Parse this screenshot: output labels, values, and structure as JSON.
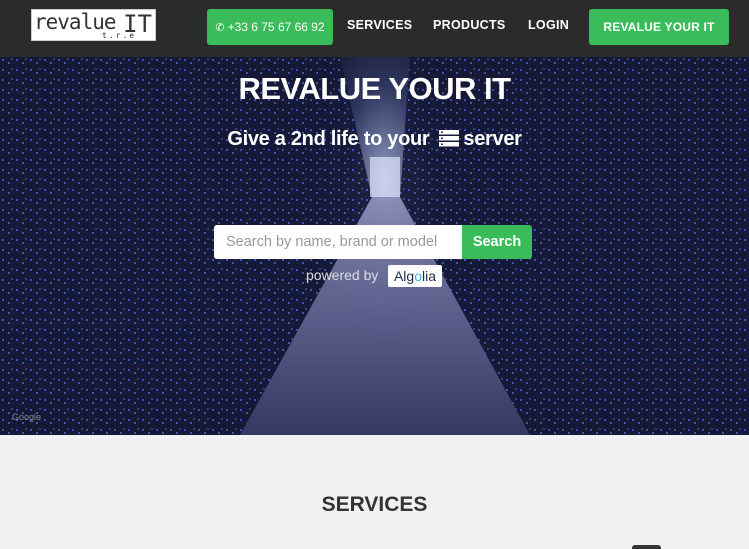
{
  "navbar": {
    "logo_main": "revalue",
    "logo_sub": "t.r.e",
    "logo_it": "IT",
    "phone": "+33 6 75 67 66 92",
    "links": [
      "SERVICES",
      "PRODUCTS",
      "LOGIN"
    ],
    "cta": "REVALUE YOUR IT"
  },
  "hero": {
    "title": "REVALUE YOUR IT",
    "subtitle_prefix": "Give a 2nd life to your",
    "subtitle_suffix": "server",
    "search_placeholder": "Search by name, brand or model",
    "search_button": "Search",
    "powered_by": "powered by",
    "algolia_pre": "Alg",
    "algolia_o": "o",
    "algolia_post": "lia",
    "google_mark": "Google"
  },
  "services": {
    "title": "SERVICES"
  },
  "colors": {
    "accent": "#3bbc5a",
    "navbar": "#2b2b2b",
    "section_bg": "#f1f1f1"
  }
}
